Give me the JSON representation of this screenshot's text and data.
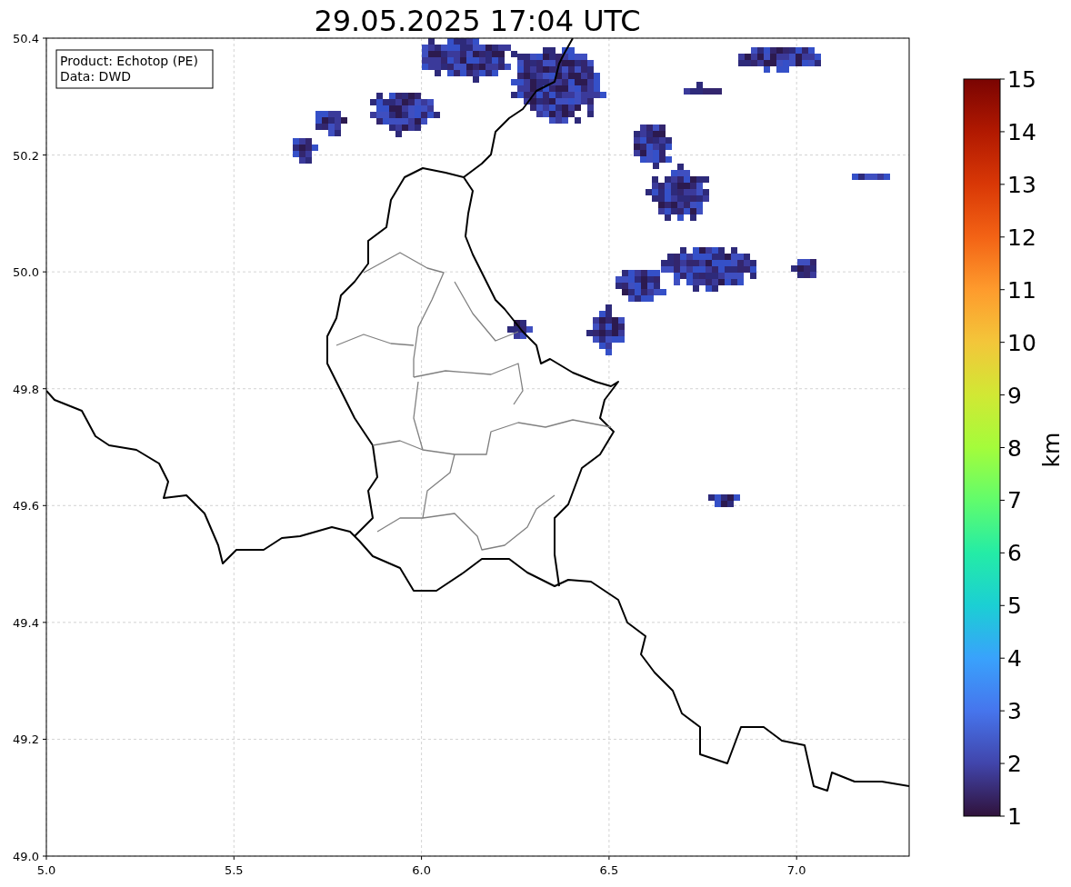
{
  "title": "29.05.2025 17:04 UTC",
  "legend": [
    "Product: Echotop (PE)",
    "Data: DWD"
  ],
  "map": {
    "x_ticks": [
      "5.0",
      "5.5",
      "6.0",
      "6.5",
      "7.0"
    ],
    "y_ticks": [
      "50.4",
      "50.2",
      "50.0",
      "49.8",
      "49.6",
      "49.4",
      "49.2",
      "49.0"
    ]
  },
  "colorbar": {
    "label": "km",
    "ticks": [
      "15",
      "14",
      "13",
      "12",
      "11",
      "10",
      "9",
      "8",
      "7",
      "6",
      "5",
      "4",
      "3",
      "2",
      "1"
    ]
  }
}
